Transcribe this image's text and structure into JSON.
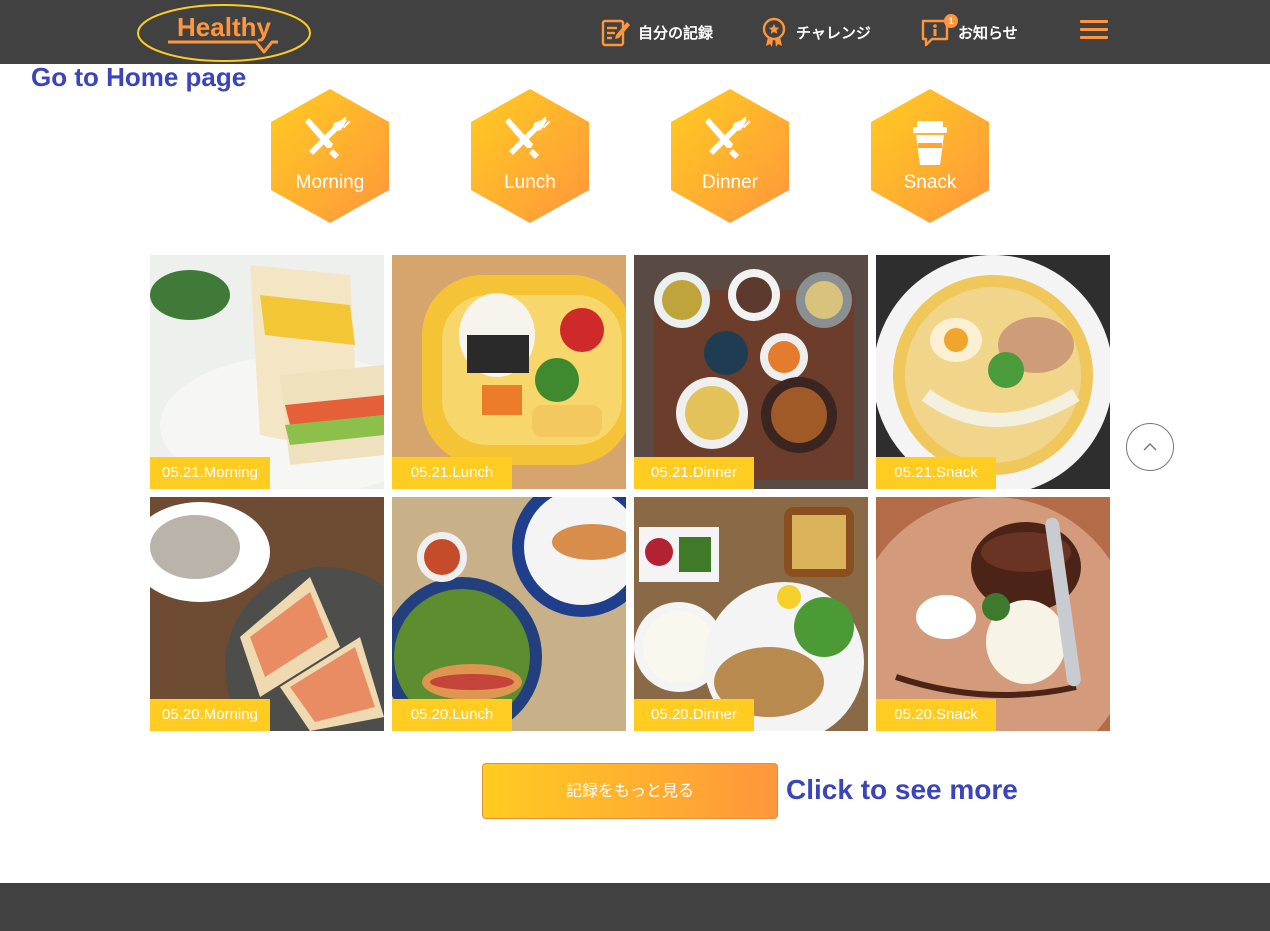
{
  "header": {
    "logo_text": "Healthy",
    "nav": [
      {
        "label": "自分の記録",
        "icon": "memo-icon"
      },
      {
        "label": "チャレンジ",
        "icon": "challenge-medal-icon"
      },
      {
        "label": "お知らせ",
        "icon": "info-notification-icon",
        "badge": "1"
      }
    ],
    "menu_icon": "hamburger-menu-icon"
  },
  "annotations": {
    "home_note": "Go to Home page",
    "more_note": "Click to see more"
  },
  "categories": [
    {
      "label": "Morning",
      "icon": "knife-fork-icon"
    },
    {
      "label": "Lunch",
      "icon": "knife-fork-icon"
    },
    {
      "label": "Dinner",
      "icon": "knife-fork-icon"
    },
    {
      "label": "Snack",
      "icon": "cup-icon"
    }
  ],
  "meals": [
    {
      "label": "05.21.Morning"
    },
    {
      "label": "05.21.Lunch"
    },
    {
      "label": "05.21.Dinner"
    },
    {
      "label": "05.21.Snack"
    },
    {
      "label": "05.20.Morning"
    },
    {
      "label": "05.20.Lunch"
    },
    {
      "label": "05.20.Dinner"
    },
    {
      "label": "05.20.Snack"
    }
  ],
  "more_button": {
    "label": "記録をもっと見る"
  },
  "colors": {
    "header_bg": "#414141",
    "accent_orange": "#ff963c",
    "accent_yellow": "#ffcc21",
    "annotation_blue": "#3b44b9"
  }
}
